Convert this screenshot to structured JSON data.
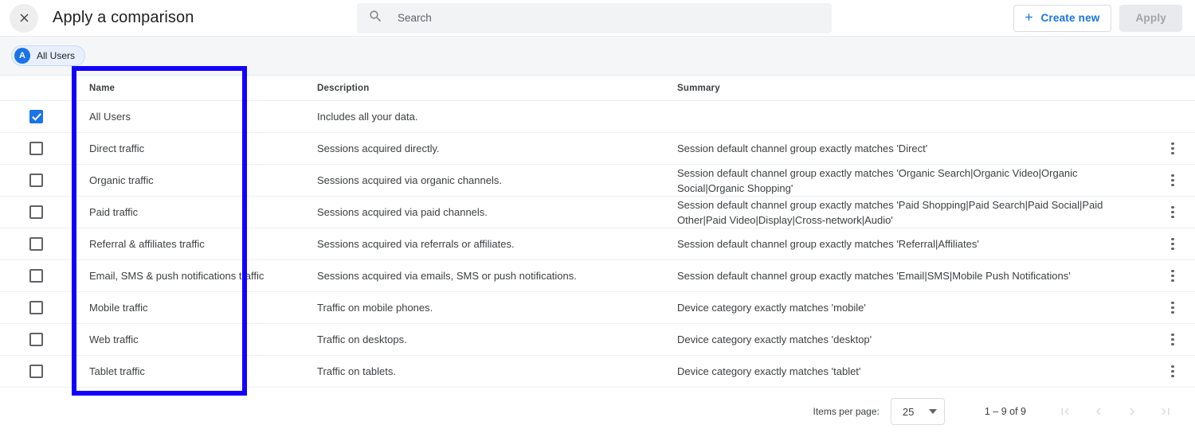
{
  "header": {
    "close_icon": "close-icon",
    "title": "Apply a comparison",
    "search": {
      "icon": "search-icon",
      "placeholder": "Search",
      "value": ""
    },
    "create_new_label": "Create new",
    "create_new_icon": "plus-icon",
    "apply_label": "Apply",
    "apply_disabled": true,
    "accent_color": "#1a73e8"
  },
  "chipbar": {
    "chips": [
      {
        "avatar_letter": "A",
        "label": "All Users"
      }
    ]
  },
  "table": {
    "columns": {
      "name": "Name",
      "description": "Description",
      "summary": "Summary"
    },
    "rows": [
      {
        "checked": true,
        "name": "All Users",
        "description": "Includes all your data.",
        "summary": "",
        "has_menu": false
      },
      {
        "checked": false,
        "name": "Direct traffic",
        "description": "Sessions acquired directly.",
        "summary": "Session default channel group exactly matches 'Direct'",
        "has_menu": true
      },
      {
        "checked": false,
        "name": "Organic traffic",
        "description": "Sessions acquired via organic channels.",
        "summary": "Session default channel group exactly matches 'Organic Search|Organic Video|Organic Social|Organic Shopping'",
        "has_menu": true
      },
      {
        "checked": false,
        "name": "Paid traffic",
        "description": "Sessions acquired via paid channels.",
        "summary": "Session default channel group exactly matches 'Paid Shopping|Paid Search|Paid Social|Paid Other|Paid Video|Display|Cross-network|Audio'",
        "has_menu": true
      },
      {
        "checked": false,
        "name": "Referral & affiliates traffic",
        "description": "Sessions acquired via referrals or affiliates.",
        "summary": "Session default channel group exactly matches 'Referral|Affiliates'",
        "has_menu": true
      },
      {
        "checked": false,
        "name": "Email, SMS & push notifications traffic",
        "description": "Sessions acquired via emails, SMS or push notifications.",
        "summary": "Session default channel group exactly matches 'Email|SMS|Mobile Push Notifications'",
        "has_menu": true
      },
      {
        "checked": false,
        "name": "Mobile traffic",
        "description": "Traffic on mobile phones.",
        "summary": "Device category exactly matches 'mobile'",
        "has_menu": true
      },
      {
        "checked": false,
        "name": "Web traffic",
        "description": "Traffic on desktops.",
        "summary": "Device category exactly matches 'desktop'",
        "has_menu": true
      },
      {
        "checked": false,
        "name": "Tablet traffic",
        "description": "Traffic on tablets.",
        "summary": "Device category exactly matches 'tablet'",
        "has_menu": true
      }
    ]
  },
  "pagination": {
    "items_per_page_label": "Items per page:",
    "items_per_page_value": "25",
    "range_label": "1 – 9 of 9",
    "first_page_icon": "first-page-icon",
    "prev_page_icon": "chevron-left-icon",
    "next_page_icon": "chevron-right-icon",
    "last_page_icon": "last-page-icon"
  },
  "annotation": {
    "color": "#1200ff",
    "target": "name-column"
  }
}
